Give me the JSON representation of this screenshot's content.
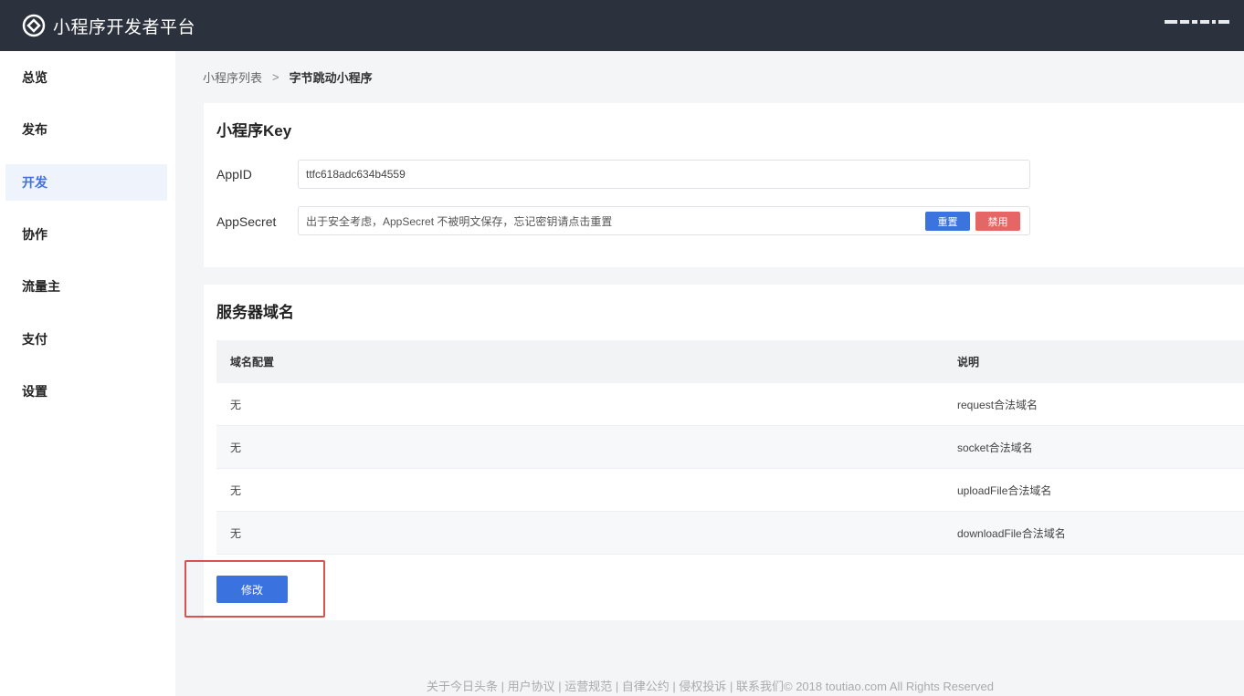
{
  "topbar": {
    "title": "小程序开发者平台",
    "logo_icon": "bytedance-dev-logo"
  },
  "sidebar": {
    "items": [
      {
        "label": "总览",
        "active": false
      },
      {
        "label": "发布",
        "active": false
      },
      {
        "label": "开发",
        "active": true
      },
      {
        "label": "协作",
        "active": false
      },
      {
        "label": "流量主",
        "active": false
      },
      {
        "label": "支付",
        "active": false
      },
      {
        "label": "设置",
        "active": false
      }
    ]
  },
  "breadcrumb": {
    "parent": "小程序列表",
    "separator": ">",
    "current": "字节跳动小程序"
  },
  "key_section": {
    "title": "小程序Key",
    "appid_label": "AppID",
    "appid_value": "ttfc618adc634b4559",
    "secret_label": "AppSecret",
    "secret_value": "出于安全考虑，AppSecret 不被明文保存，忘记密钥请点击重置",
    "reset_button": "重置",
    "disable_button": "禁用"
  },
  "domain_section": {
    "title": "服务器域名",
    "columns": [
      "域名配置",
      "说明"
    ],
    "rows": [
      [
        "无",
        "request合法域名"
      ],
      [
        "无",
        "socket合法域名"
      ],
      [
        "无",
        "uploadFile合法域名"
      ],
      [
        "无",
        "downloadFile合法域名"
      ]
    ],
    "edit_button": "修改"
  },
  "footer": {
    "text": "关于今日头条 | 用户协议 | 运营规范 | 自律公约 | 侵权投诉 | 联系我们© 2018 toutiao.com All Rights Reserved"
  },
  "colors": {
    "topbar_bg": "#2b313d",
    "accent_blue": "#3a72e0",
    "danger_red": "#e66565",
    "highlight_red": "#d9524f"
  }
}
